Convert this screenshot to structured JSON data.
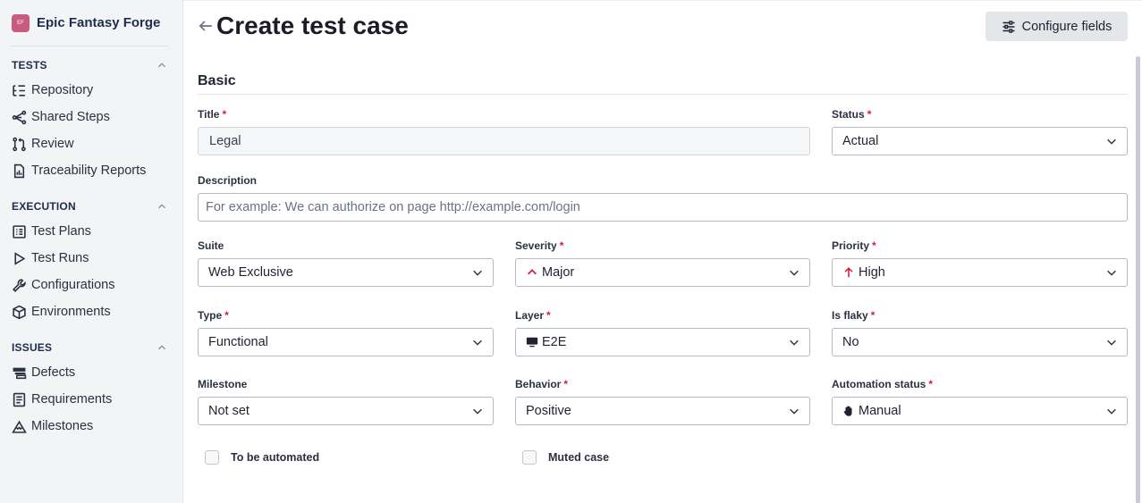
{
  "sidebar": {
    "project": {
      "logo_text": "EF",
      "name": "Epic Fantasy Forge"
    },
    "sections": [
      {
        "title": "TESTS",
        "items": [
          "Repository",
          "Shared Steps",
          "Review",
          "Traceability Reports"
        ]
      },
      {
        "title": "EXECUTION",
        "items": [
          "Test Plans",
          "Test Runs",
          "Configurations",
          "Environments"
        ]
      },
      {
        "title": "ISSUES",
        "items": [
          "Defects",
          "Requirements",
          "Milestones"
        ]
      }
    ]
  },
  "header": {
    "title": "Create test case",
    "configure_label": "Configure fields"
  },
  "form": {
    "section": "Basic",
    "title": {
      "label": "Title",
      "value": "Legal"
    },
    "status": {
      "label": "Status",
      "value": "Actual"
    },
    "description": {
      "label": "Description",
      "placeholder": "For example: We can authorize on page http://example.com/login"
    },
    "suite": {
      "label": "Suite",
      "value": "Web Exclusive"
    },
    "severity": {
      "label": "Severity",
      "value": "Major"
    },
    "priority": {
      "label": "Priority",
      "value": "High"
    },
    "type": {
      "label": "Type",
      "value": "Functional"
    },
    "layer": {
      "label": "Layer",
      "value": "E2E"
    },
    "is_flaky": {
      "label": "Is flaky",
      "value": "No"
    },
    "milestone": {
      "label": "Milestone",
      "value": "Not set"
    },
    "behavior": {
      "label": "Behavior",
      "value": "Positive"
    },
    "automation_status": {
      "label": "Automation status",
      "value": "Manual"
    },
    "to_be_automated": {
      "label": "To be automated",
      "checked": false
    },
    "muted_case": {
      "label": "Muted case",
      "checked": false
    },
    "required_marker": "*"
  },
  "colors": {
    "required": "#d41e3c",
    "project_logo": "#c95a80",
    "sidebar_bg": "#f3f4f6"
  }
}
